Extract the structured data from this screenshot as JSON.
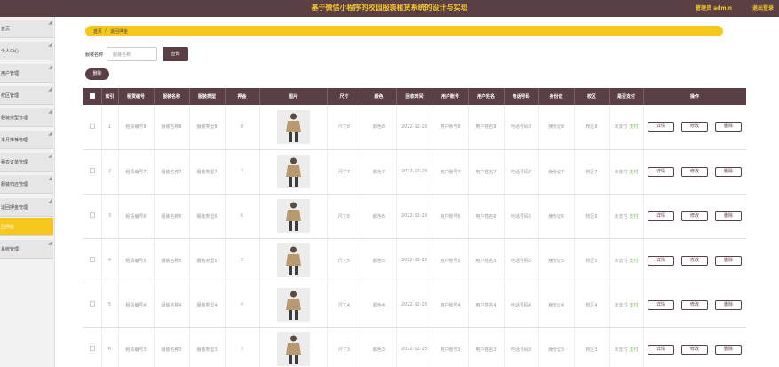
{
  "header": {
    "title": "基于微信小程序的校园服装租赁系统的设计与实现",
    "admin_label": "管理员 admin",
    "logout_label": "退出登录"
  },
  "sidebar": {
    "items": [
      {
        "label": "首页"
      },
      {
        "label": "个人中心"
      },
      {
        "label": "用户管理"
      },
      {
        "label": "校区管理"
      },
      {
        "label": "服装类型管理"
      },
      {
        "label": "本月推荐管理"
      },
      {
        "label": "租衣订单管理"
      },
      {
        "label": "服装归还管理"
      },
      {
        "label": "退回押金管理"
      },
      {
        "label": "回押金"
      },
      {
        "label": "系统管理"
      }
    ],
    "active_index": 9
  },
  "breadcrumb": {
    "home": "首页",
    "separator": "/",
    "current": "退回押金"
  },
  "search": {
    "label": "服装名称",
    "placeholder": "服装名称",
    "button_label": "查询"
  },
  "toolbar": {
    "delete_label": "删除"
  },
  "table": {
    "columns": [
      "",
      "索引",
      "租赁编号",
      "服装名称",
      "服装类型",
      "押金",
      "图片",
      "尺寸",
      "颜色",
      "回收时间",
      "用户账号",
      "用户姓名",
      "电话号码",
      "身份证",
      "校区",
      "是否支付",
      "操作"
    ],
    "rows": [
      {
        "index": "1",
        "rental_no": "租赁编号8",
        "clothing_name": "服装名称8",
        "clothing_type": "服装类型8",
        "deposit": "8",
        "size": "尺寸8",
        "color": "颜色8",
        "time": "2022-12-28",
        "account": "用户账号8",
        "user_name": "用户姓名8",
        "phone": "电话号码8",
        "id_card": "身份证8",
        "campus": "校区8",
        "pay_status": "未支付",
        "pay_link": "支付"
      },
      {
        "index": "2",
        "rental_no": "租赁编号7",
        "clothing_name": "服装名称7",
        "clothing_type": "服装类型7",
        "deposit": "7",
        "size": "尺寸7",
        "color": "颜色7",
        "time": "2022-12-28",
        "account": "用户账号7",
        "user_name": "用户姓名7",
        "phone": "电话号码7",
        "id_card": "身份证7",
        "campus": "校区7",
        "pay_status": "未支付",
        "pay_link": "支付"
      },
      {
        "index": "3",
        "rental_no": "租赁编号6",
        "clothing_name": "服装名称6",
        "clothing_type": "服装类型6",
        "deposit": "6",
        "size": "尺寸6",
        "color": "颜色6",
        "time": "2022-12-28",
        "account": "用户账号6",
        "user_name": "用户姓名6",
        "phone": "电话号码6",
        "id_card": "身份证6",
        "campus": "校区6",
        "pay_status": "未支付",
        "pay_link": "支付"
      },
      {
        "index": "4",
        "rental_no": "租赁编号5",
        "clothing_name": "服装名称5",
        "clothing_type": "服装类型5",
        "deposit": "5",
        "size": "尺寸5",
        "color": "颜色5",
        "time": "2022-12-28",
        "account": "用户账号5",
        "user_name": "用户姓名5",
        "phone": "电话号码5",
        "id_card": "身份证5",
        "campus": "校区5",
        "pay_status": "未支付",
        "pay_link": "支付"
      },
      {
        "index": "5",
        "rental_no": "租赁编号4",
        "clothing_name": "服装名称4",
        "clothing_type": "服装类型4",
        "deposit": "4",
        "size": "尺寸4",
        "color": "颜色4",
        "time": "2022-12-28",
        "account": "用户账号4",
        "user_name": "用户姓名4",
        "phone": "电话号码4",
        "id_card": "身份证4",
        "campus": "校区4",
        "pay_status": "未支付",
        "pay_link": "支付"
      },
      {
        "index": "6",
        "rental_no": "租赁编号3",
        "clothing_name": "服装名称3",
        "clothing_type": "服装类型3",
        "deposit": "3",
        "size": "尺寸3",
        "color": "颜色3",
        "time": "2022-12-28",
        "account": "用户账号3",
        "user_name": "用户姓名3",
        "phone": "电话号码3",
        "id_card": "身份证3",
        "campus": "校区3",
        "pay_status": "未支付",
        "pay_link": "支付"
      }
    ],
    "action_labels": {
      "detail": "详情",
      "edit": "修改",
      "delete": "删除"
    }
  },
  "colors": {
    "primary": "#5a3f45",
    "accent": "#f6c71d",
    "paid_link": "#6ab04c"
  }
}
